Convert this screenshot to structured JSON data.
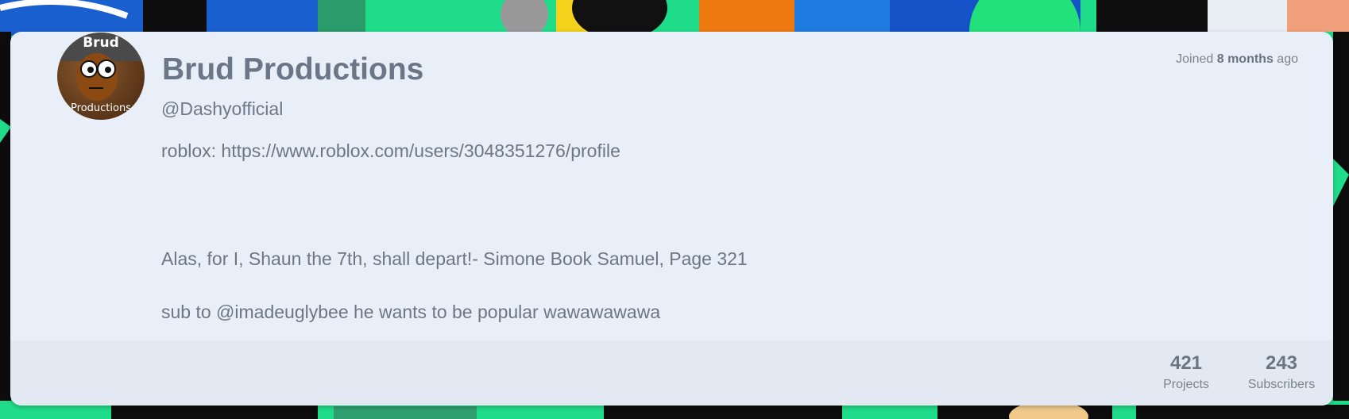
{
  "profile": {
    "display_name": "Brud Productions",
    "handle": "@Dashyofficial",
    "avatar_top_text": "Brud",
    "avatar_bottom_text": "Productions",
    "joined_prefix": "Joined",
    "joined_value": "8 months",
    "joined_suffix": "ago",
    "bio_lines": [
      "roblox: https://www.roblox.com/users/3048351276/profile",
      "Alas, for I, Shaun the 7th, shall depart!- Simone Book Samuel, Page 321",
      "sub to @imadeuglybee he wants to be popular wawawawawa"
    ]
  },
  "stats": {
    "projects_count": "421",
    "projects_label": "Projects",
    "subscribers_count": "243",
    "subscribers_label": "Subscribers"
  },
  "colors": {
    "card_background": "#e8eff8",
    "text_primary": "#6b7686",
    "banner_accent": "#1fdc8a"
  }
}
